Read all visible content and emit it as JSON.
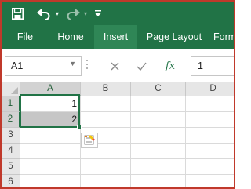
{
  "quick_access": {
    "save_icon": "save-icon",
    "undo_icon": "undo-icon",
    "redo_icon": "redo-icon",
    "customize_icon": "customize-qat-icon"
  },
  "ribbon": {
    "tabs": [
      {
        "label": "File",
        "active": false
      },
      {
        "label": "Home",
        "active": false
      },
      {
        "label": "Insert",
        "active": true
      },
      {
        "label": "Page Layout",
        "active": false
      },
      {
        "label": "Form",
        "active": false
      }
    ]
  },
  "formula_bar": {
    "name_box": "A1",
    "cancel_icon": "cancel-icon",
    "enter_icon": "enter-icon",
    "fx_label": "fx",
    "content": "1"
  },
  "sheet": {
    "columns": [
      "A",
      "B",
      "C",
      "D"
    ],
    "rows": [
      "1",
      "2",
      "3",
      "4",
      "5",
      "6"
    ],
    "cells": {
      "A1": "1",
      "A2": "2"
    },
    "selection": "A1:A2",
    "quick_analysis_icon": "quick-analysis-icon"
  },
  "colors": {
    "ribbon": "#217346",
    "active_tab": "#2f8656",
    "selection": "#217346",
    "frame_border": "#c0392b"
  }
}
